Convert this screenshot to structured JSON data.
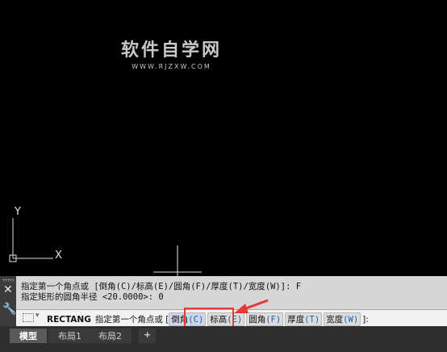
{
  "watermark": {
    "title": "软件自学网",
    "url": "WWW.RJZXW.COM"
  },
  "ucs": {
    "y_label": "Y",
    "x_label": "X"
  },
  "history": [
    "指定第一个角点或 [倒角(C)/标高(E)/圆角(F)/厚度(T)/宽度(W)]: F",
    "指定矩形的圆角半径 <20.0000>: 0"
  ],
  "command_line": {
    "command": "RECTANG",
    "prompt": "指定第一个角点或",
    "open_bracket": "[",
    "close_bracket": "]:",
    "options": [
      {
        "label": "倒角",
        "key": "(C)"
      },
      {
        "label": "标高",
        "key": "(E)"
      },
      {
        "label": "圆角",
        "key": "(F)"
      },
      {
        "label": "厚度",
        "key": "(T)"
      },
      {
        "label": "宽度",
        "key": "(W)"
      }
    ]
  },
  "tabs": {
    "model": "模型",
    "layout1": "布局1",
    "layout2": "布局2",
    "add": "+"
  },
  "colors": {
    "canvas": "#000000",
    "highlight_box": "#e53935",
    "option_key": "#1a5fb4"
  },
  "icons": [
    "close-icon",
    "wrench-icon",
    "command-prompt-icon",
    "ucs-icon"
  ]
}
